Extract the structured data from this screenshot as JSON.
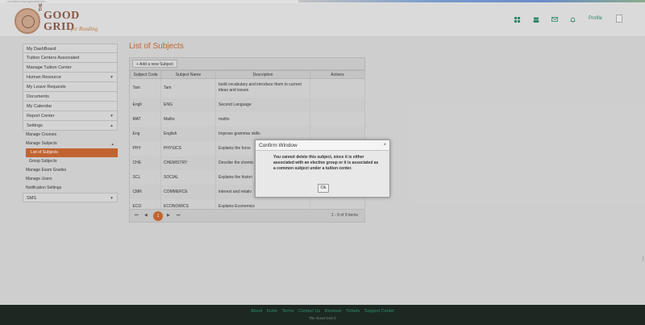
{
  "browser": {
    "url": "...com/dev/managesubjects/..."
  },
  "logo": {
    "the": "THE",
    "good": "GOOD",
    "grid": "GRID",
    "tagline": "for Reading"
  },
  "topnav": {
    "profile": "Profile"
  },
  "sidebar": {
    "items": [
      {
        "label": "My DashBoard"
      },
      {
        "label": "Tuition Centers Associated"
      },
      {
        "label": "Manage Tuition Center"
      },
      {
        "label": "Human Resource"
      },
      {
        "label": "My Leave Requests"
      },
      {
        "label": "Documents"
      },
      {
        "label": "My Calendar"
      },
      {
        "label": "Report Center"
      },
      {
        "label": "Settings"
      }
    ],
    "settings_sub": [
      {
        "label": "Manage Courses"
      },
      {
        "label": "Manage Subjects"
      },
      {
        "label": "List of Subjects"
      },
      {
        "label": "Group Subjects"
      },
      {
        "label": "Manage Exam Grades"
      },
      {
        "label": "Manage Users"
      },
      {
        "label": "Notification Settings"
      }
    ],
    "sms": "SMS"
  },
  "page": {
    "title": "List of Subjects"
  },
  "toolbar": {
    "add_label": "Add a new Subject"
  },
  "table": {
    "headers": [
      "Subject Code",
      "Subject Name",
      "Description",
      "Actions"
    ],
    "rows": [
      {
        "code": "Tam",
        "name": "Tam",
        "desc": "build vocabulary and introduce them to current ideas and issues"
      },
      {
        "code": "Engli",
        "name": "ENG",
        "desc": "Second Language"
      },
      {
        "code": "MAT",
        "name": "Maths",
        "desc": "maths"
      },
      {
        "code": "Eng",
        "name": "English",
        "desc": "Improve grammar skills"
      },
      {
        "code": "PHY",
        "name": "PHYSICS",
        "desc": "Explains the force"
      },
      {
        "code": "CHE",
        "name": "CHEMISTRY",
        "desc": "Descibe the chemic"
      },
      {
        "code": "SCL",
        "name": "SOCIAL",
        "desc": "Explains the histori"
      },
      {
        "code": "CMR",
        "name": "COMMERCE",
        "desc": "interest and relativ"
      },
      {
        "code": "ECO",
        "name": "ECONOMICS",
        "desc": "Explains Economics"
      }
    ]
  },
  "pager": {
    "current": "1",
    "info": "1 - 9 of 9 items"
  },
  "dialog": {
    "title": "Confirm Window",
    "message": "You cannot delete this subject, since it is either associated with an elective group or it is associated as a common subject under a tuition center.",
    "ok": "Ok"
  },
  "footer": {
    "links": [
      "About",
      "Invite",
      "Terms",
      "Contact Us",
      "Reviews",
      "Tickets",
      "Support Center"
    ],
    "copyright": "The Good Grid ©"
  },
  "colors": {
    "accent": "#c8652f",
    "link": "#2c8f6c",
    "footer_bg": "#1d2823"
  }
}
